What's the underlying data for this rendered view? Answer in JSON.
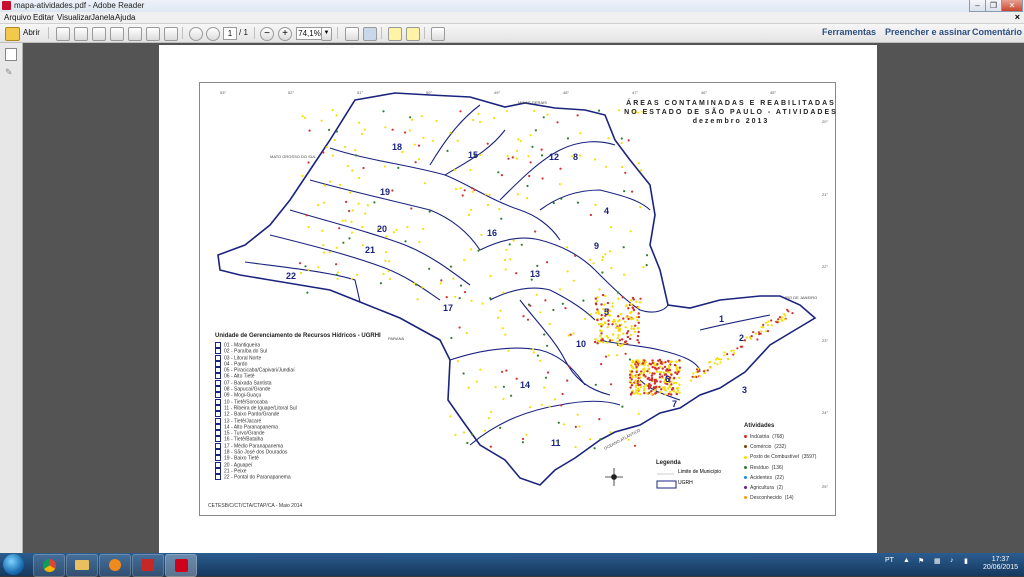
{
  "window": {
    "title": "mapa-atividades.pdf - Adobe Reader"
  },
  "menu": [
    "Arquivo",
    "Editar",
    "Visualizar",
    "Janela",
    "Ajuda"
  ],
  "toolbar": {
    "open_label": "Abrir",
    "page_current": "1",
    "page_total": "/ 1",
    "zoom": "74,1%",
    "right_links": [
      "Ferramentas",
      "Preencher e assinar",
      "Comentário"
    ]
  },
  "map": {
    "title_lines": [
      "ÁREAS CONTAMINADAS E REABILITADAS",
      "NO ESTADO DE SÃO PAULO - ATIVIDADES",
      "dezembro 2013"
    ],
    "region_numbers": [
      {
        "n": "18"
      },
      {
        "n": "15"
      },
      {
        "n": "12"
      },
      {
        "n": "8"
      },
      {
        "n": "19"
      },
      {
        "n": "4"
      },
      {
        "n": "20"
      },
      {
        "n": "16"
      },
      {
        "n": "9"
      },
      {
        "n": "21"
      },
      {
        "n": "22"
      },
      {
        "n": "13"
      },
      {
        "n": "17"
      },
      {
        "n": "5"
      },
      {
        "n": "1"
      },
      {
        "n": "10"
      },
      {
        "n": "2"
      },
      {
        "n": "14"
      },
      {
        "n": "6"
      },
      {
        "n": "7"
      },
      {
        "n": "3"
      },
      {
        "n": "11"
      }
    ],
    "neighbor_labels": [
      "MATO GROSSO DO SUL",
      "MINAS GERAIS",
      "RIO DE JANEIRO",
      "PARANÁ",
      "OCEANO ATLÂNTICO"
    ],
    "lon_ticks": [
      "53°",
      "52°",
      "51°",
      "50°",
      "49°",
      "48°",
      "47°",
      "46°",
      "45°"
    ],
    "lat_ticks": [
      "20°",
      "21°",
      "22°",
      "23°",
      "24°",
      "25°"
    ],
    "credit": "CETESB/C/CT/CTA/CTAP/CA - Maio 2014"
  },
  "ugrhi_legend": {
    "title": "Unidade de Gerenciamento de Recursos Hídricos - UGRHI",
    "items": [
      "01 - Mantiqueira",
      "02 - Paraíba do Sul",
      "03 - Litoral Norte",
      "04 - Pardo",
      "05 - Piracicaba/Capivari/Jundiaí",
      "06 - Alto Tietê",
      "07 - Baixada Santista",
      "08 - Sapucaí/Grande",
      "09 - Mogi-Guaçu",
      "10 - Tietê/Sorocaba",
      "11 - Ribeira de Iguape/Litoral Sul",
      "12 - Baixo Pardo/Grande",
      "13 - Tietê/Jacaré",
      "14 - Alto Paranapanema",
      "15 - Turvo/Grande",
      "16 - Tietê/Batalha",
      "17 - Médio Paranapanema",
      "18 - São José dos Dourados",
      "19 - Baixo Tietê",
      "20 - Aguapeí",
      "21 - Peixe",
      "22 - Pontal do Paranapanema"
    ]
  },
  "legenda": {
    "title": "Legenda",
    "municipio": "Limite de Município",
    "ugrh": "UGRH"
  },
  "atividades": {
    "title": "Atividades",
    "items": [
      {
        "label": "Indústria",
        "count": "(768)",
        "color": "#d32f2f"
      },
      {
        "label": "Comércio",
        "count": "(232)",
        "color": "#7b3f00"
      },
      {
        "label": "Posto de Combustível",
        "count": "(3597)",
        "color": "#f5e000"
      },
      {
        "label": "Resíduo",
        "count": "(136)",
        "color": "#2e7d32"
      },
      {
        "label": "Acidentes",
        "count": "(22)",
        "color": "#1e88e5"
      },
      {
        "label": "Agricultura",
        "count": "(2)",
        "color": "#6a1b9a"
      },
      {
        "label": "Desconhecido",
        "count": "(14)",
        "color": "#ff9800"
      }
    ]
  },
  "taskbar": {
    "lang": "PT",
    "time": "17:37",
    "date": "20/06/2015"
  }
}
